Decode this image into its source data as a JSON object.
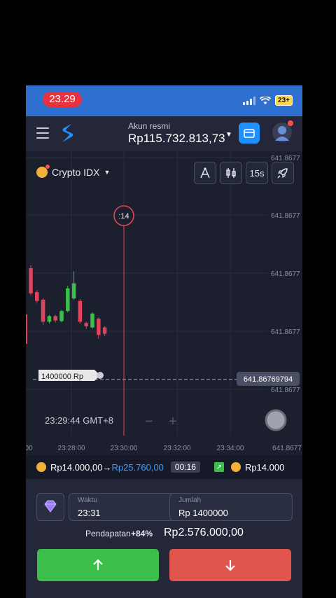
{
  "status_bar": {
    "time": "23.29",
    "battery": "23+"
  },
  "header": {
    "account_label": "Akun resmi",
    "balance": "Rp115.732.813,73"
  },
  "asset": {
    "name": "Crypto IDX"
  },
  "toolbar": {
    "timeframe": "15s"
  },
  "chart": {
    "price_ticks": [
      "641.8677",
      "641.8677",
      "641.8677",
      "641.8677",
      "641.8677"
    ],
    "current_price": "641.86769794",
    "countdown": ":14",
    "clock": "23:29:44 GMT+8",
    "time_ticks": [
      "00",
      "23:28:00",
      "23:30:00",
      "23:32:00",
      "23:34:00",
      "641.8677"
    ],
    "trade_tag": "1400000 Rp",
    "candles": [
      {
        "dir": "down",
        "o": 7,
        "c": 3,
        "h": 7.5,
        "l": 2.7
      },
      {
        "dir": "down",
        "o": 3.2,
        "c": 1.8,
        "h": 3.5,
        "l": 1.5
      },
      {
        "dir": "down",
        "o": 2,
        "c": -1.5,
        "h": 2.3,
        "l": -2
      },
      {
        "dir": "up",
        "o": -1.5,
        "c": -0.6,
        "h": -0.4,
        "l": -1.8
      },
      {
        "dir": "down",
        "o": -0.6,
        "c": -1.3,
        "h": -0.4,
        "l": -1.6
      },
      {
        "dir": "up",
        "o": -1.4,
        "c": 0.2,
        "h": 0.4,
        "l": -1.6
      },
      {
        "dir": "up",
        "o": 0.2,
        "c": 3.8,
        "h": 4.2,
        "l": 0
      },
      {
        "dir": "up",
        "o": 2.2,
        "c": 4.6,
        "h": 6.5,
        "l": 2
      },
      {
        "dir": "down",
        "o": 1.8,
        "c": -1.5,
        "h": 2.1,
        "l": -1.8
      },
      {
        "dir": "down",
        "o": -1.7,
        "c": -2.2,
        "h": -1.5,
        "l": -2.6
      },
      {
        "dir": "up",
        "o": -2.4,
        "c": -0.2,
        "h": 0,
        "l": -2.6
      },
      {
        "dir": "down",
        "o": -1,
        "c": -3.6,
        "h": -0.8,
        "l": -4.2
      },
      {
        "dir": "down",
        "o": -2.4,
        "c": -3.4,
        "h": -2.2,
        "l": -3.8
      }
    ]
  },
  "profit_bar": {
    "amount_from": "Rp14.000,00",
    "arrow": "→",
    "amount_to": "Rp25.760,00",
    "timer": "00:16",
    "amount_next": "Rp14.000"
  },
  "trade": {
    "time_label": "Waktu",
    "time_value": "23:31",
    "amount_label": "Jumlah",
    "amount_value": "Rp 1400000",
    "income_label": "Pendapatan",
    "income_pct": "+84%",
    "payout": "Rp2.576.000,00"
  },
  "colors": {
    "up": "#3cbf4a",
    "down": "#e0445a",
    "accent": "#1e90ff"
  }
}
